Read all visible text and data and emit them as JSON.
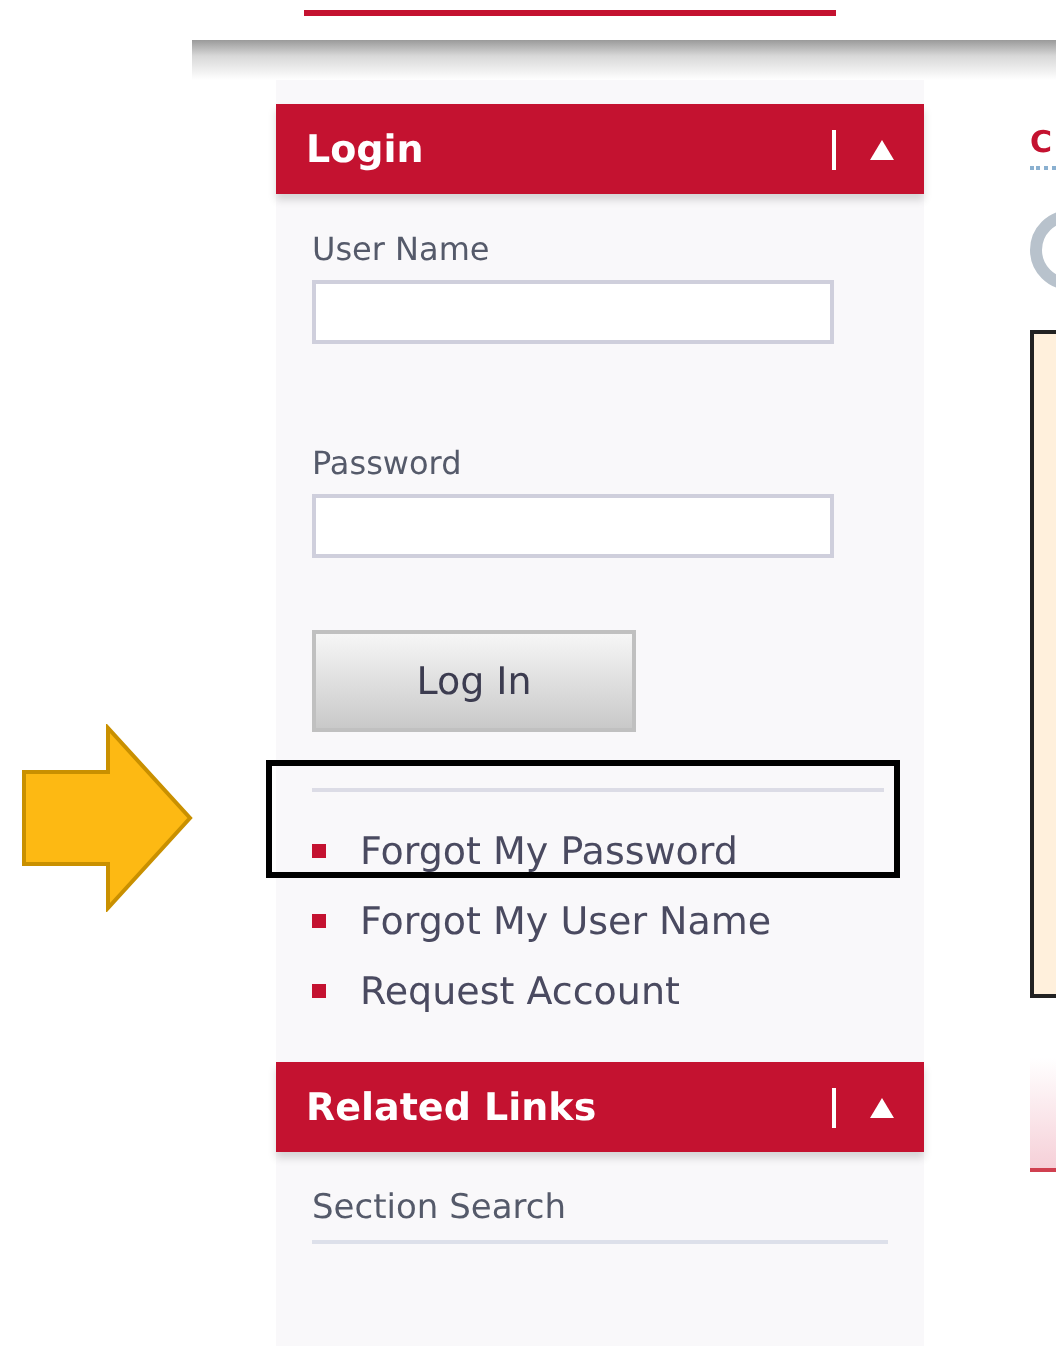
{
  "login_panel": {
    "title": "Login",
    "expanded": true,
    "fields": [
      {
        "label": "User Name"
      },
      {
        "label": "Password"
      }
    ],
    "button": "Log In",
    "links": [
      {
        "label": "Forgot My Password",
        "highlighted": true
      },
      {
        "label": "Forgot My User Name",
        "highlighted": false
      },
      {
        "label": "Request Account",
        "highlighted": false
      }
    ]
  },
  "related_links_panel": {
    "title": "Related Links",
    "expanded": true,
    "items": [
      "Section Search"
    ]
  },
  "content": {
    "heading": "C"
  }
}
